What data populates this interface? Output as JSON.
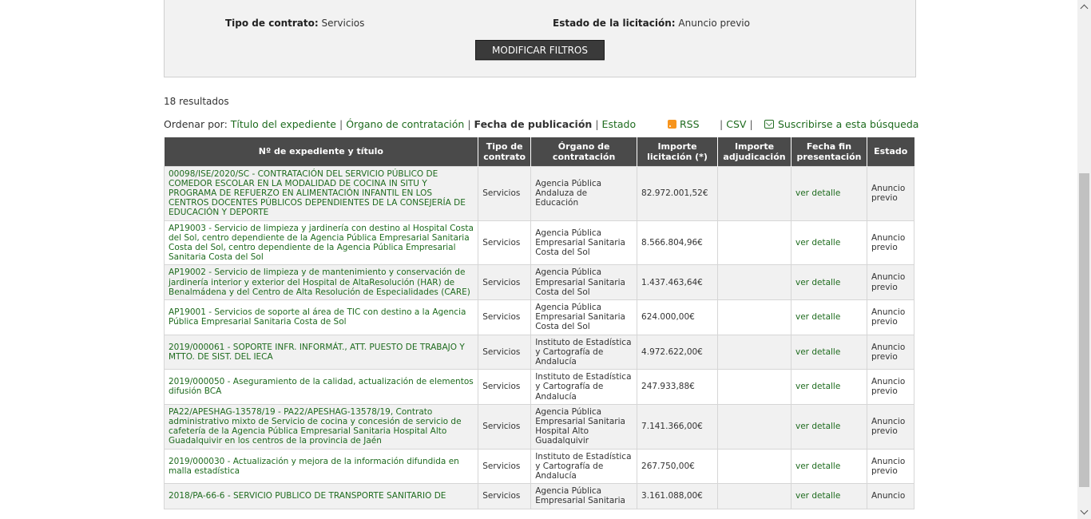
{
  "filters": {
    "tipo_label": "Tipo de contrato:",
    "tipo_value": "Servicios",
    "estado_label": "Estado de la licitación:",
    "estado_value": "Anuncio previo",
    "modify_button": "MODIFICAR FILTROS"
  },
  "results_count": "18 resultados",
  "sort": {
    "label": "Ordenar por:",
    "options": [
      "Título del expediente",
      "Órgano de contratación",
      "Fecha de publicación",
      "Estado"
    ],
    "active": "Fecha de publicación",
    "rss": "RSS",
    "csv": "CSV",
    "subscribe": "Suscribirse a esta búsqueda",
    "icons": {
      "rss": "rss-icon",
      "subscribe": "envelope-icon"
    }
  },
  "table": {
    "headers": [
      "Nº de expediente y título",
      "Tipo de contrato",
      "Órgano de contratación",
      "Importe licitación (*)",
      "Importe adjudicación",
      "Fecha fin presentación",
      "Estado"
    ],
    "rows": [
      {
        "title": "00098/ISE/2020/SC - CONTRATACIÓN DEL SERVICIO PÚBLICO DE COMEDOR ESCOLAR EN LA MODALIDAD DE COCINA IN SITU Y PROGRAMA DE REFUERZO EN ALIMENTACIÓN INFANTIL EN LOS CENTROS DOCENTES PÚBLICOS DEPENDIENTES DE LA CONSEJERÍA DE EDUCACIÓN Y DEPORTE",
        "tipo": "Servicios",
        "organo": "Agencia Pública Andaluza de Educación",
        "importe": "82.972.001,52€",
        "adjudicacion": "",
        "fecha": "ver detalle",
        "estado": "Anuncio previo"
      },
      {
        "title": "AP19003 - Servicio de limpieza y jardinería con destino al Hospital Costa del Sol, centro dependiente de la Agencia Pública Empresarial Sanitaria Costa del Sol, centro dependiente de la Agencia Pública Empresarial Sanitaria Costa del Sol",
        "tipo": "Servicios",
        "organo": "Agencia Pública Empresarial Sanitaria Costa del Sol",
        "importe": "8.566.804,96€",
        "adjudicacion": "",
        "fecha": "ver detalle",
        "estado": "Anuncio previo"
      },
      {
        "title": "AP19002 - Servicio de limpieza y de mantenimiento y conservación de jardinería interior y exterior del Hospital de AltaResolución (HAR) de Benalmádena y del Centro de Alta Resolución de Especialidades (CARE)",
        "tipo": "Servicios",
        "organo": "Agencia Pública Empresarial Sanitaria Costa del Sol",
        "importe": "1.437.463,64€",
        "adjudicacion": "",
        "fecha": "ver detalle",
        "estado": "Anuncio previo"
      },
      {
        "title": "AP19001 - Servicios de soporte al área de TIC con destino a la Agencia Pública Empresarial Sanitaria Costa de Sol",
        "tipo": "Servicios",
        "organo": "Agencia Pública Empresarial Sanitaria Costa del Sol",
        "importe": "624.000,00€",
        "adjudicacion": "",
        "fecha": "ver detalle",
        "estado": "Anuncio previo"
      },
      {
        "title": "2019/000061 - SOPORTE INFR. INFORMÁT., ATT. PUESTO DE TRABAJO Y MTTO. DE SIST. DEL IECA",
        "tipo": "Servicios",
        "organo": "Instituto de Estadística y Cartografía de Andalucía",
        "importe": "4.972.622,00€",
        "adjudicacion": "",
        "fecha": "ver detalle",
        "estado": "Anuncio previo"
      },
      {
        "title": "2019/000050 - Aseguramiento de la calidad, actualización de elementos difusión BCA",
        "tipo": "Servicios",
        "organo": "Instituto de Estadística y Cartografía de Andalucía",
        "importe": "247.933,88€",
        "adjudicacion": "",
        "fecha": "ver detalle",
        "estado": "Anuncio previo"
      },
      {
        "title": "PA22/APESHAG-13578/19 - PA22/APESHAG-13578/19, Contrato administrativo mixto de Servicio de cocina y concesión de servicio de cafetería de la Agencia Pública Empresarial Sanitaria Hospital Alto Guadalquivir en los centros de la provincia de Jaén",
        "tipo": "Servicios",
        "organo": "Agencia Pública Empresarial Sanitaria Hospital Alto Guadalquivir",
        "importe": "7.141.366,00€",
        "adjudicacion": "",
        "fecha": "ver detalle",
        "estado": "Anuncio previo"
      },
      {
        "title": "2019/000030 - Actualización y mejora de la información difundida en malla estadística",
        "tipo": "Servicios",
        "organo": "Instituto de Estadística y Cartografía de Andalucía",
        "importe": "267.750,00€",
        "adjudicacion": "",
        "fecha": "ver detalle",
        "estado": "Anuncio previo"
      },
      {
        "title": "2018/PA-66-6 - SERVICIO PUBLICO DE TRANSPORTE SANITARIO DE",
        "tipo": "Servicios",
        "organo": "Agencia Pública Empresarial Sanitaria",
        "importe": "3.161.088,00€",
        "adjudicacion": "",
        "fecha": "ver detalle",
        "estado": "Anuncio"
      }
    ]
  }
}
